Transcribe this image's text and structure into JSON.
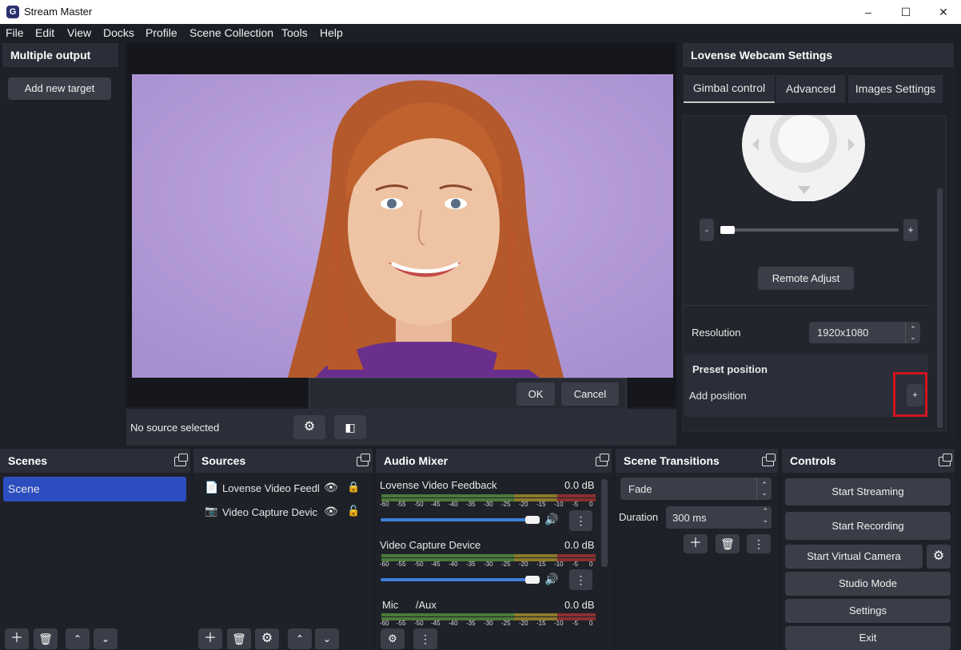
{
  "window": {
    "app_icon": "G",
    "title": "Stream Master",
    "controls": [
      "minimize-icon",
      "maximize-icon",
      "close-icon"
    ]
  },
  "menu": [
    "File",
    "Edit",
    "View",
    "Docks",
    "Profile",
    "Scene Collection",
    "Tools",
    "Help"
  ],
  "multiple_output": {
    "title": "Multiple output",
    "add_target": "Add new target"
  },
  "preview": {
    "status": "No source selected",
    "dialog": {
      "ok": "OK",
      "cancel": "Cancel"
    }
  },
  "webcam_settings": {
    "title": "Lovense Webcam Settings",
    "tabs": [
      "Gimbal control",
      "Advanced",
      "Images Settings"
    ],
    "active_tab": "Gimbal control",
    "zoom_minus": "-",
    "zoom_plus": "+",
    "remote_adjust": "Remote Adjust",
    "resolution_label": "Resolution",
    "resolution_value": "1920x1080",
    "preset_title": "Preset position",
    "add_position": "Add position",
    "add_position_button": "+"
  },
  "scenes": {
    "title": "Scenes",
    "items": [
      "Scene"
    ]
  },
  "sources": {
    "title": "Sources",
    "items": [
      "Lovense Video Feedl",
      "Video Capture Devic"
    ]
  },
  "audio_mixer": {
    "title": "Audio Mixer",
    "scale": [
      "-60",
      "-55",
      "-50",
      "-45",
      "-40",
      "-35",
      "-30",
      "-25",
      "-20",
      "-15",
      "-10",
      "-5",
      "0"
    ],
    "channels": [
      {
        "name": "Lovense Video Feedback",
        "level": "0.0 dB"
      },
      {
        "name": "Video Capture Device",
        "level": "0.0 dB"
      },
      {
        "name": "Mic      /Aux",
        "level": "0.0 dB"
      }
    ]
  },
  "scene_transitions": {
    "title": "Scene Transitions",
    "transition": "Fade",
    "duration_label": "Duration",
    "duration_value": "300 ms"
  },
  "controls": {
    "title": "Controls",
    "start_streaming": "Start Streaming",
    "start_recording": "Start Recording",
    "start_virtual_camera": "Start Virtual Camera",
    "studio_mode": "Studio Mode",
    "settings": "Settings",
    "exit": "Exit"
  },
  "colors": {
    "accent": "#2b4dc0",
    "highlight_box": "#d0141f",
    "bg": "#1d1f26"
  }
}
